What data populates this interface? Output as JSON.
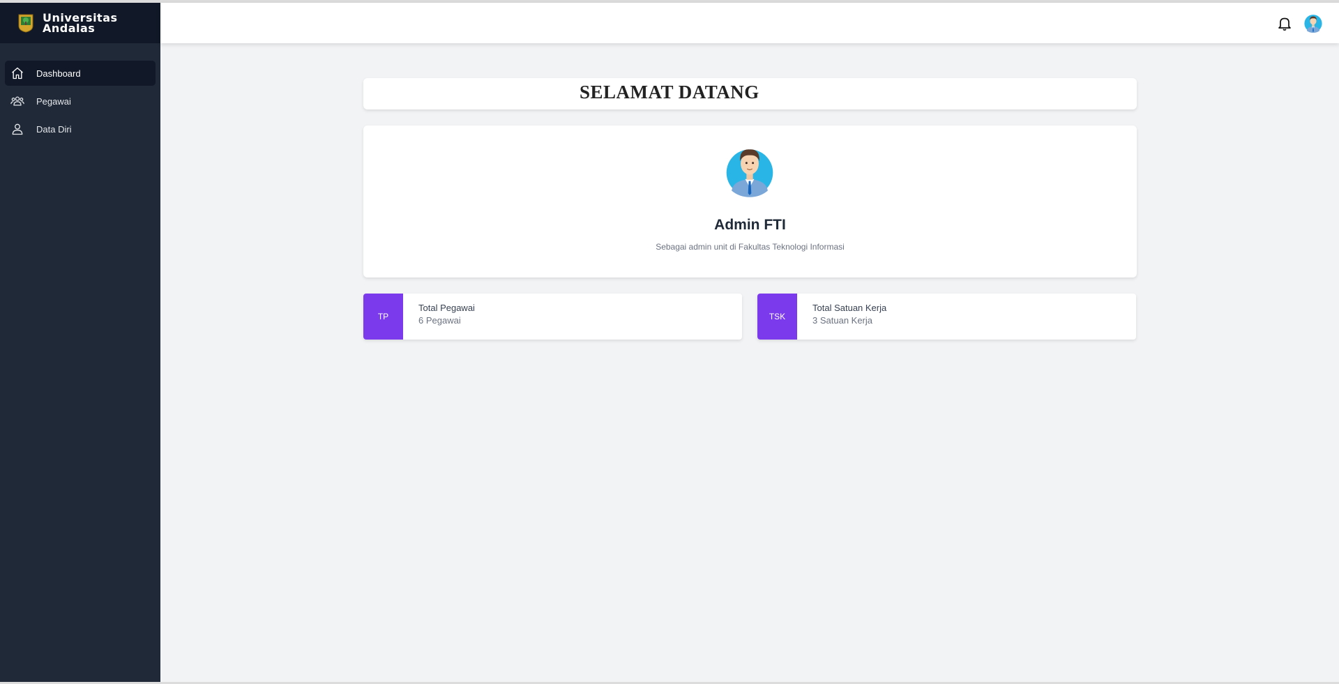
{
  "brand": {
    "line1": "Universitas",
    "line2": "Andalas"
  },
  "sidebar": {
    "items": [
      {
        "label": "Dashboard",
        "icon": "home-icon",
        "active": true
      },
      {
        "label": "Pegawai",
        "icon": "users-icon",
        "active": false
      },
      {
        "label": "Data Diri",
        "icon": "user-icon",
        "active": false
      }
    ]
  },
  "topbar": {
    "icons": [
      "bell-icon",
      "avatar"
    ]
  },
  "welcome": {
    "title": "SELAMAT DATANG"
  },
  "profile": {
    "name": "Admin FTI",
    "description": "Sebagai admin unit di Fakultas Teknologi Informasi"
  },
  "stats": [
    {
      "badge": "TP",
      "title": "Total Pegawai",
      "value": "6 Pegawai"
    },
    {
      "badge": "TSK",
      "title": "Total Satuan Kerja",
      "value": "3 Satuan Kerja"
    }
  ],
  "colors": {
    "sidebar": "#1f2937",
    "sidebar_dark": "#111827",
    "accent": "#7c3aed",
    "background": "#f2f3f5"
  }
}
